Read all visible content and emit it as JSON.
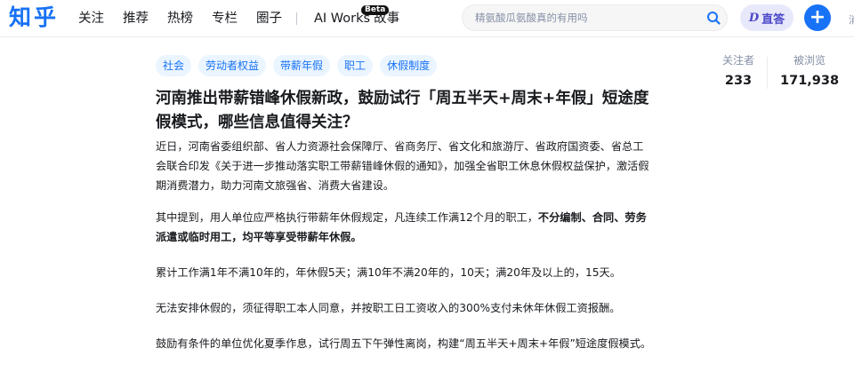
{
  "header": {
    "logo": "知乎",
    "nav": [
      "关注",
      "推荐",
      "热榜",
      "专栏",
      "圈子"
    ],
    "ai_works": "AI Works",
    "beta": "Beta",
    "story": "故事",
    "search_placeholder": "精氨酸瓜氨酸真的有用吗",
    "ask_button": "直答",
    "ask_mark": "D",
    "plus": "+",
    "edge": "消"
  },
  "question": {
    "tags": [
      "社会",
      "劳动者权益",
      "带薪年假",
      "职工",
      "休假制度"
    ],
    "title": "河南推出带薪错峰休假新政，鼓励试行「周五半天+周末+年假」短途度假模式，哪些信息值得关注？",
    "paragraphs": {
      "p1": "近日，河南省委组织部、省人力资源社会保障厅、省商务厅、省文化和旅游厅、省政府国资委、省总工会联合印发《关于进一步推动落实职工带薪错峰休假的通知》，加强全省职工休息休假权益保护，激活假期消费潜力，助力河南文旅强省、消费大省建设。",
      "p2_prefix": "其中提到，用人单位应严格执行带薪年休假规定，凡连续工作满12个月的职工，",
      "p2_bold": "不分编制、合同、劳务派遣或临时用工，均平等享受带薪年休假。",
      "p3": "累计工作满1年不满10年的，年休假5天；满10年不满20年的，10天；满20年及以上的，15天。",
      "p4": "无法安排休假的，须征得职工本人同意，并按职工日工资收入的300%支付未休年休假工资报酬。",
      "p5": "鼓励有条件的单位优化夏季作息，试行周五下午弹性离岗，构建“周五半天+周末+年假”短途度假模式。"
    }
  },
  "stats": {
    "followers_label": "关注者",
    "followers_value": "233",
    "views_label": "被浏览",
    "views_value": "171,938"
  },
  "colors": {
    "brand": "#1772f6",
    "tag_bg": "#ebf5ff",
    "ask_bg": "#e8e8fb",
    "ask_text": "#4b47c8"
  }
}
